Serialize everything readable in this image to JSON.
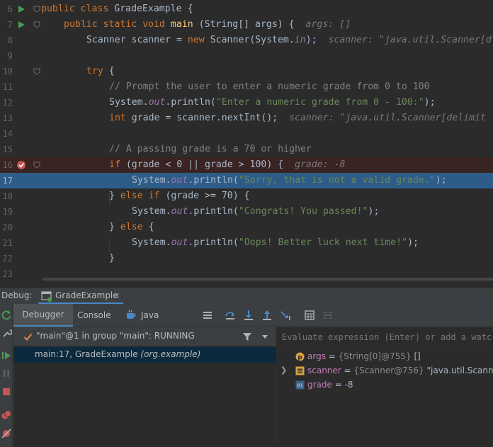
{
  "editor": {
    "lines": [
      {
        "num": "6"
      },
      {
        "num": "7"
      },
      {
        "num": "8"
      },
      {
        "num": "9"
      },
      {
        "num": "10"
      },
      {
        "num": "11"
      },
      {
        "num": "12"
      },
      {
        "num": "13"
      },
      {
        "num": "14"
      },
      {
        "num": "15"
      },
      {
        "num": "16"
      },
      {
        "num": "17"
      },
      {
        "num": "18"
      },
      {
        "num": "19"
      },
      {
        "num": "20"
      },
      {
        "num": "21"
      },
      {
        "num": "22"
      },
      {
        "num": "23"
      }
    ],
    "code": {
      "l6": {
        "kw1": "public",
        "kw2": "class",
        "name": "GradeExample",
        "brace": "{"
      },
      "l7": {
        "kw1": "public",
        "kw2": "static",
        "kw3": "void",
        "fn": "main",
        "rest": "(String[] args) {",
        "hint": "args: []"
      },
      "l8": {
        "pre": "Scanner scanner = ",
        "kw": "new",
        "mid": " Scanner(System.",
        "st": "in",
        "post": ");",
        "hint": "scanner: \"java.util.Scanner[d"
      },
      "l10": {
        "kw": "try",
        "rest": " {"
      },
      "l11": {
        "comment": "// Prompt the user to enter a numeric grade from 0 to 100"
      },
      "l12": {
        "pre": "System.",
        "st": "out",
        "mid": ".println(",
        "str": "\"Enter a numeric grade from 0 - 100:\"",
        "post": ");"
      },
      "l13": {
        "kw": "int",
        "rest": " grade = scanner.nextInt();",
        "hint": "scanner: \"java.util.Scanner[delimit"
      },
      "l15": {
        "comment": "// A passing grade is a 70 or higher"
      },
      "l16": {
        "kw": "if",
        "rest": " (grade < 0 || grade > 100) {",
        "hint": "grade: -8"
      },
      "l17": {
        "pre": "System.",
        "st": "out",
        "mid": ".println(",
        "str": "\"Sorry, that is not a valid grade.\"",
        "post": ");"
      },
      "l18": {
        "a": "} ",
        "kw1": "else",
        "b": " ",
        "kw2": "if",
        "c": " (grade >= 70) {"
      },
      "l19": {
        "pre": "System.",
        "st": "out",
        "mid": ".println(",
        "str": "\"Congrats! You passed!\"",
        "post": ");"
      },
      "l20": {
        "a": "} ",
        "kw": "else",
        "b": " {"
      },
      "l21": {
        "pre": "System.",
        "st": "out",
        "mid": ".println(",
        "str": "\"Oops! Better luck next time!\"",
        "post": ");"
      },
      "l22": {
        "brace": "}"
      }
    }
  },
  "debug_window": {
    "label": "Debug:",
    "session_tab": "GradeExample",
    "session_close": "×",
    "tabs": {
      "debugger": "Debugger",
      "console": "Console",
      "java_visualizer": "Java Visualizer"
    },
    "thread": "\"main\"@1 in group \"main\": RUNNING",
    "frame": {
      "location": "main:17, GradeExample ",
      "package": "(org.example)"
    },
    "evaluate_placeholder": "Evaluate expression (Enter) or add a watch",
    "variables": [
      {
        "name": "args",
        "type": "{String[0]@755}",
        "value": " []",
        "icon": "parameter-icon",
        "expandable": false
      },
      {
        "name": "scanner",
        "type": "{Scanner@756}",
        "value": " \"java.util.Scanner[delim",
        "icon": "field-icon",
        "expandable": true
      },
      {
        "name": "grade",
        "type": "",
        "value": "-8",
        "icon": "primitive-icon",
        "expandable": false
      }
    ]
  },
  "colors": {
    "editor_bg": "#2b2b2b",
    "execution_line": "#2d5c88",
    "breakpoint_line": "#3a2323",
    "keyword": "#cc7832",
    "string": "#6a8759",
    "comment": "#808080",
    "static_field": "#9876aa",
    "method_decl": "#ffc66d",
    "run_green": "#499c54",
    "breakpoint_red": "#c75450",
    "accent_blue": "#4a88c7"
  }
}
